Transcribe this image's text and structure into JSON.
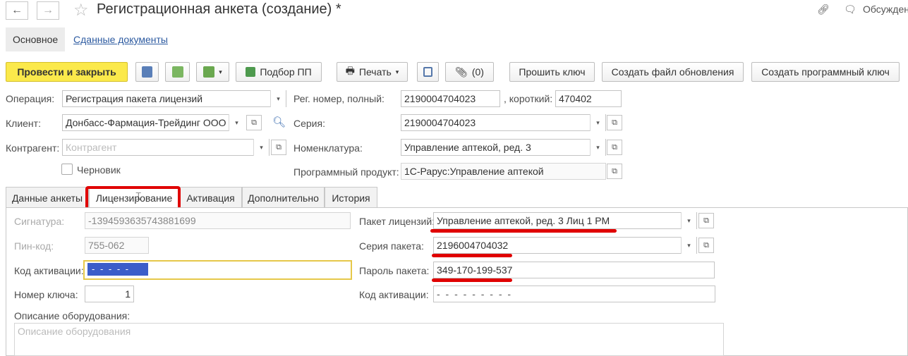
{
  "window": {
    "title": "Регистрационная анкета (создание) *",
    "top_right_label": "Обсужден"
  },
  "section_tabs": {
    "main": "Основное",
    "submitted_docs": "Сданные документы"
  },
  "toolbar": {
    "post_close": "Провести и закрыть",
    "pick_pp": "Подбор ПП",
    "print": "Печать",
    "attachments": "(0)",
    "flash_key": "Прошить ключ",
    "create_update": "Создать файл обновления",
    "create_key": "Создать программный ключ"
  },
  "form": {
    "operation_label": "Операция:",
    "operation_value": "Регистрация пакета лицензий",
    "client_label": "Клиент:",
    "client_value": "Донбасс-Фармация-Трейдинг ООО",
    "contractor_label": "Контрагент:",
    "contractor_placeholder": "Контрагент",
    "draft_label": "Черновик",
    "reg_full_label": "Рег. номер, полный:",
    "reg_full_value": "2190004704023",
    "reg_short_label": ", короткий:",
    "reg_short_value": "470402",
    "series_label": "Серия:",
    "series_value": "2190004704023",
    "nomenclature_label": "Номенклатура:",
    "nomenclature_value": "Управление аптекой, ред. 3",
    "product_label": "Программный продукт:",
    "product_value": "1С-Рарус:Управление аптекой"
  },
  "tabs": [
    "Данные анкеты",
    "Лицензирование",
    "Активация",
    "Дополнительно",
    "История"
  ],
  "licensing": {
    "signature_label": "Сигнатура:",
    "signature_value": "-1394593635743881699",
    "pin_label": "Пин-код:",
    "pin_value": "755-062",
    "activation_code_label": "Код активации:",
    "activation_code_value": "- - - - -",
    "key_number_label": "Номер ключа:",
    "key_number_value": "1",
    "equipment_label": "Описание оборудования:",
    "equipment_placeholder": "Описание оборудования",
    "package_label": "Пакет лицензий:",
    "package_value": "Управление аптекой, ред. 3 Лиц 1 РМ",
    "package_series_label": "Серия пакета:",
    "package_series_value": "2196004704032",
    "package_password_label": "Пароль пакета:",
    "package_password_value": "349-170-199-537",
    "activation_code2_label": "Код активации:",
    "activation_code2_value": "- - - - - - - - -"
  },
  "colors": {
    "accent_yellow": "#fbe94b",
    "highlight_red": "#e00000",
    "link_blue": "#2c5aa0",
    "selection_blue": "#3b5dc9"
  }
}
